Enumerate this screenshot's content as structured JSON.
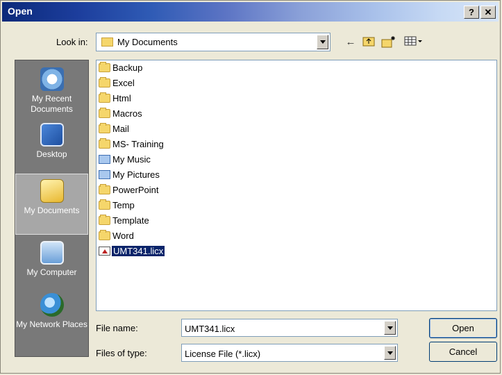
{
  "window": {
    "title": "Open",
    "help_label": "?",
    "close_label": "✕"
  },
  "lookin": {
    "label": "Look in:",
    "value": "My Documents",
    "icon": "folder-icon"
  },
  "toolbar": {
    "icons": [
      "back-arrow-icon",
      "up-one-level-icon",
      "new-folder-icon",
      "views-menu-icon"
    ]
  },
  "places": [
    {
      "label": "My Recent Documents",
      "icon": "recent-documents-icon",
      "selected": false
    },
    {
      "label": "Desktop",
      "icon": "desktop-icon",
      "selected": false
    },
    {
      "label": "My Documents",
      "icon": "my-documents-icon",
      "selected": true
    },
    {
      "label": "My Computer",
      "icon": "my-computer-icon",
      "selected": false
    },
    {
      "label": "My Network Places",
      "icon": "network-places-icon",
      "selected": false
    }
  ],
  "files": [
    {
      "name": "Backup",
      "type": "folder"
    },
    {
      "name": "Excel",
      "type": "folder"
    },
    {
      "name": "Html",
      "type": "folder"
    },
    {
      "name": "Macros",
      "type": "folder"
    },
    {
      "name": "Mail",
      "type": "folder"
    },
    {
      "name": "MS- Training",
      "type": "folder"
    },
    {
      "name": "My Music",
      "type": "special"
    },
    {
      "name": "My Pictures",
      "type": "special"
    },
    {
      "name": "PowerPoint",
      "type": "folder"
    },
    {
      "name": "Temp",
      "type": "folder"
    },
    {
      "name": "Template",
      "type": "folder"
    },
    {
      "name": "Word",
      "type": "folder"
    },
    {
      "name": "UMT341.licx",
      "type": "licx",
      "selected": true
    }
  ],
  "filename": {
    "label": "File name:",
    "value": "UMT341.licx"
  },
  "filetype": {
    "label": "Files of type:",
    "value": "License File (*.licx)"
  },
  "buttons": {
    "open": "Open",
    "cancel": "Cancel"
  },
  "colors": {
    "selection": "#0a246a",
    "places_bg": "#797979",
    "dialog_bg": "#ece9d8"
  }
}
